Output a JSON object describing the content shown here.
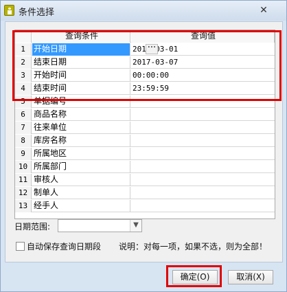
{
  "window": {
    "title": "条件选择",
    "close_symbol": "✕"
  },
  "grid": {
    "header": {
      "condition": "查询条件",
      "value": "查询值"
    },
    "rows": [
      {
        "num": "1",
        "condition": "开始日期",
        "value": "2017-03-01"
      },
      {
        "num": "2",
        "condition": "结束日期",
        "value": "2017-03-07"
      },
      {
        "num": "3",
        "condition": "开始时间",
        "value": "00:00:00"
      },
      {
        "num": "4",
        "condition": "结束时间",
        "value": "23:59:59"
      },
      {
        "num": "5",
        "condition": "单据编号",
        "value": ""
      },
      {
        "num": "6",
        "condition": "商品名称",
        "value": ""
      },
      {
        "num": "7",
        "condition": "往来单位",
        "value": ""
      },
      {
        "num": "8",
        "condition": "库房名称",
        "value": ""
      },
      {
        "num": "9",
        "condition": "所属地区",
        "value": ""
      },
      {
        "num": "10",
        "condition": "所属部门",
        "value": ""
      },
      {
        "num": "11",
        "condition": "审核人",
        "value": ""
      },
      {
        "num": "12",
        "condition": "制单人",
        "value": ""
      },
      {
        "num": "13",
        "condition": "经手人",
        "value": ""
      }
    ],
    "ellipsis": "···"
  },
  "date_range": {
    "label": "日期范围:",
    "value": ""
  },
  "auto_save": {
    "label": "自动保存查询日期段",
    "checked": false
  },
  "note": "说明：对每一项，如果不选，则为全部！",
  "buttons": {
    "ok": "确定(O)",
    "cancel": "取消(X)"
  },
  "colors": {
    "highlight": "#e00000",
    "selection": "#3399ff"
  }
}
